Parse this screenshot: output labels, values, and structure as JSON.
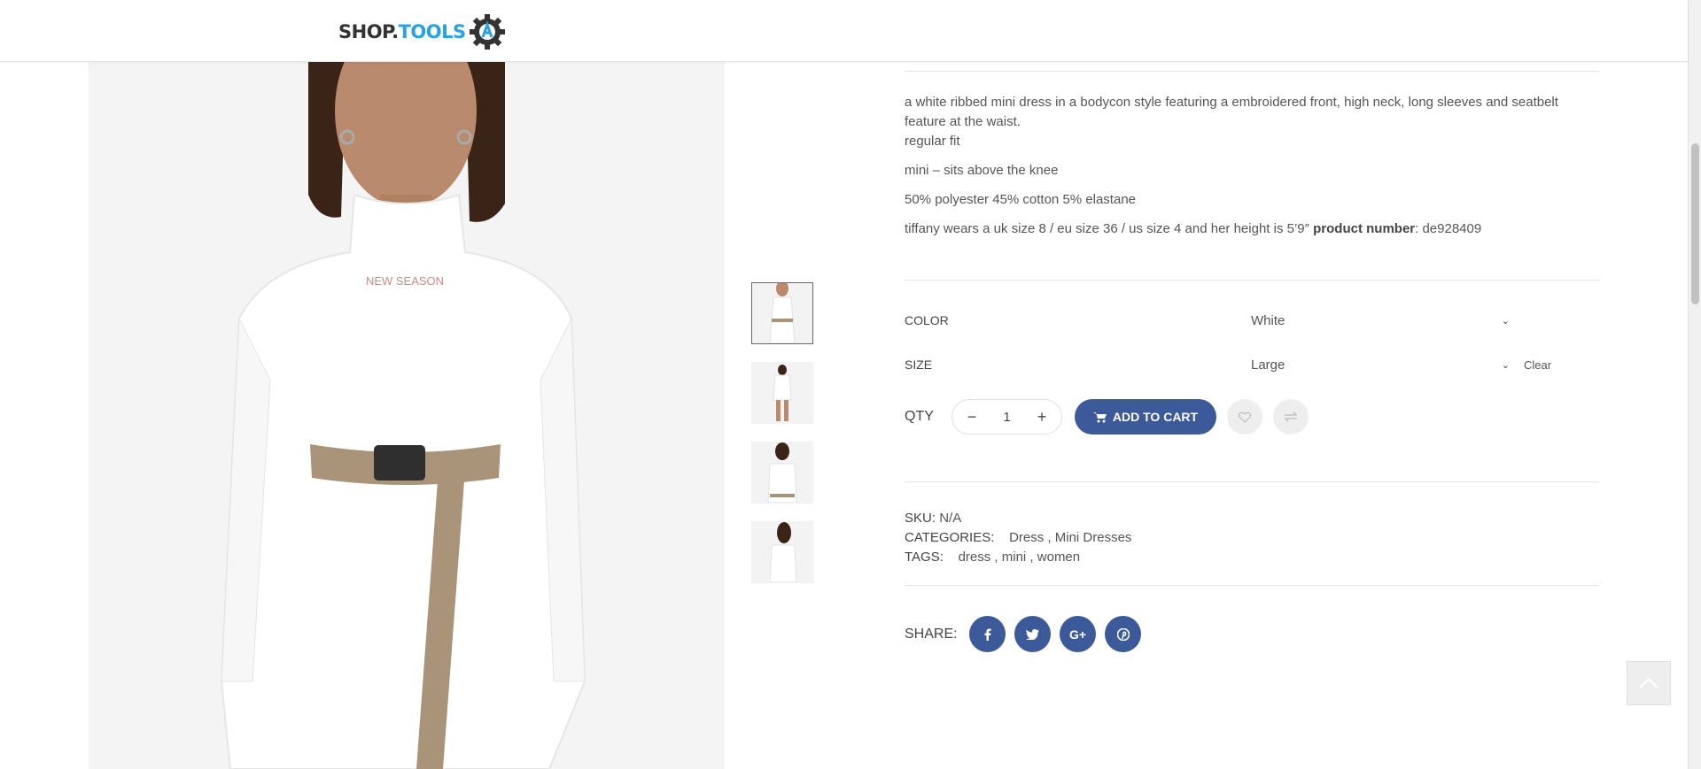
{
  "header": {
    "logo_part1": "SHOP.",
    "logo_part2": "TOOLS"
  },
  "product": {
    "description_line1": "a white ribbed mini dress in a bodycon style featuring a embroidered front, high neck, long sleeves and seatbelt feature at the waist.",
    "description_line2": "regular fit",
    "description_line3": "mini – sits above the knee",
    "description_line4": "50% polyester 45% cotton 5% elastane",
    "description_line5_a": "tiffany wears a uk size 8 / eu size 36 / us size 4 and her height is 5’9″ ",
    "description_line5_b": "product number",
    "description_line5_c": ": de928409",
    "print_text": "NEW SEASON"
  },
  "variations": {
    "color_label": "COLOR",
    "color_value": "White",
    "size_label": "SIZE",
    "size_value": "Large",
    "clear_label": "Clear"
  },
  "cart": {
    "qty_label": "QTY",
    "qty_value": "1",
    "minus": "−",
    "plus": "+",
    "add_label": "ADD TO CART"
  },
  "meta": {
    "sku_label": "SKU:",
    "sku_value": "N/A",
    "categories_label": "CATEGORIES:",
    "categories_value": "Dress , Mini Dresses",
    "tags_label": "TAGS:",
    "tags_value": "dress , mini , women"
  },
  "share": {
    "label": "SHARE:",
    "networks": [
      "facebook-icon",
      "twitter-icon",
      "google-plus-icon",
      "pinterest-icon"
    ]
  },
  "colors": {
    "accent": "#3c5a99",
    "logo_blue": "#2aa1e0"
  }
}
